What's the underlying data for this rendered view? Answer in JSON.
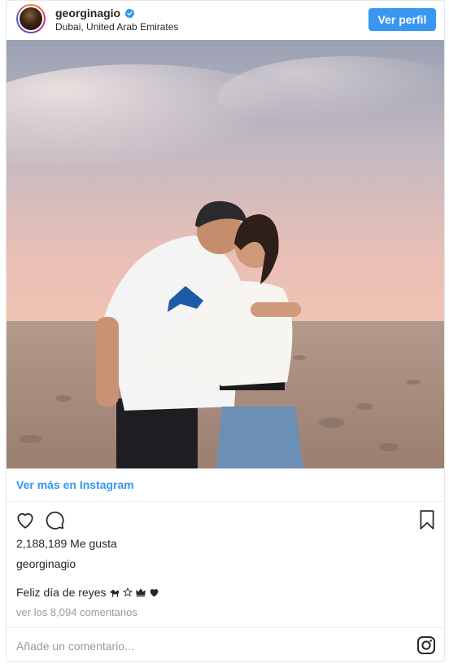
{
  "header": {
    "username": "georginagio",
    "location": "Dubai, United Arab Emirates",
    "follow_label": "Ver perfil"
  },
  "post": {
    "see_more_label": "Ver más en Instagram",
    "likes": "2,188,189 Me gusta",
    "caption_user": "georginagio",
    "caption_text": "Feliz día de reyes",
    "caption_emojis": [
      "camel",
      "star",
      "crown",
      "heart"
    ],
    "comments_link": "ver los 8,094 comentarios",
    "comment_placeholder": "Añade un comentario..."
  },
  "icons": {
    "like": "heart-outline-icon",
    "comment": "speech-bubble-icon",
    "save": "bookmark-icon",
    "instagram": "instagram-logo-icon",
    "verified": "verified-badge-icon"
  },
  "colors": {
    "accent": "#3897f0",
    "text": "#262626",
    "muted": "#999999",
    "border": "#e6e6e6"
  }
}
